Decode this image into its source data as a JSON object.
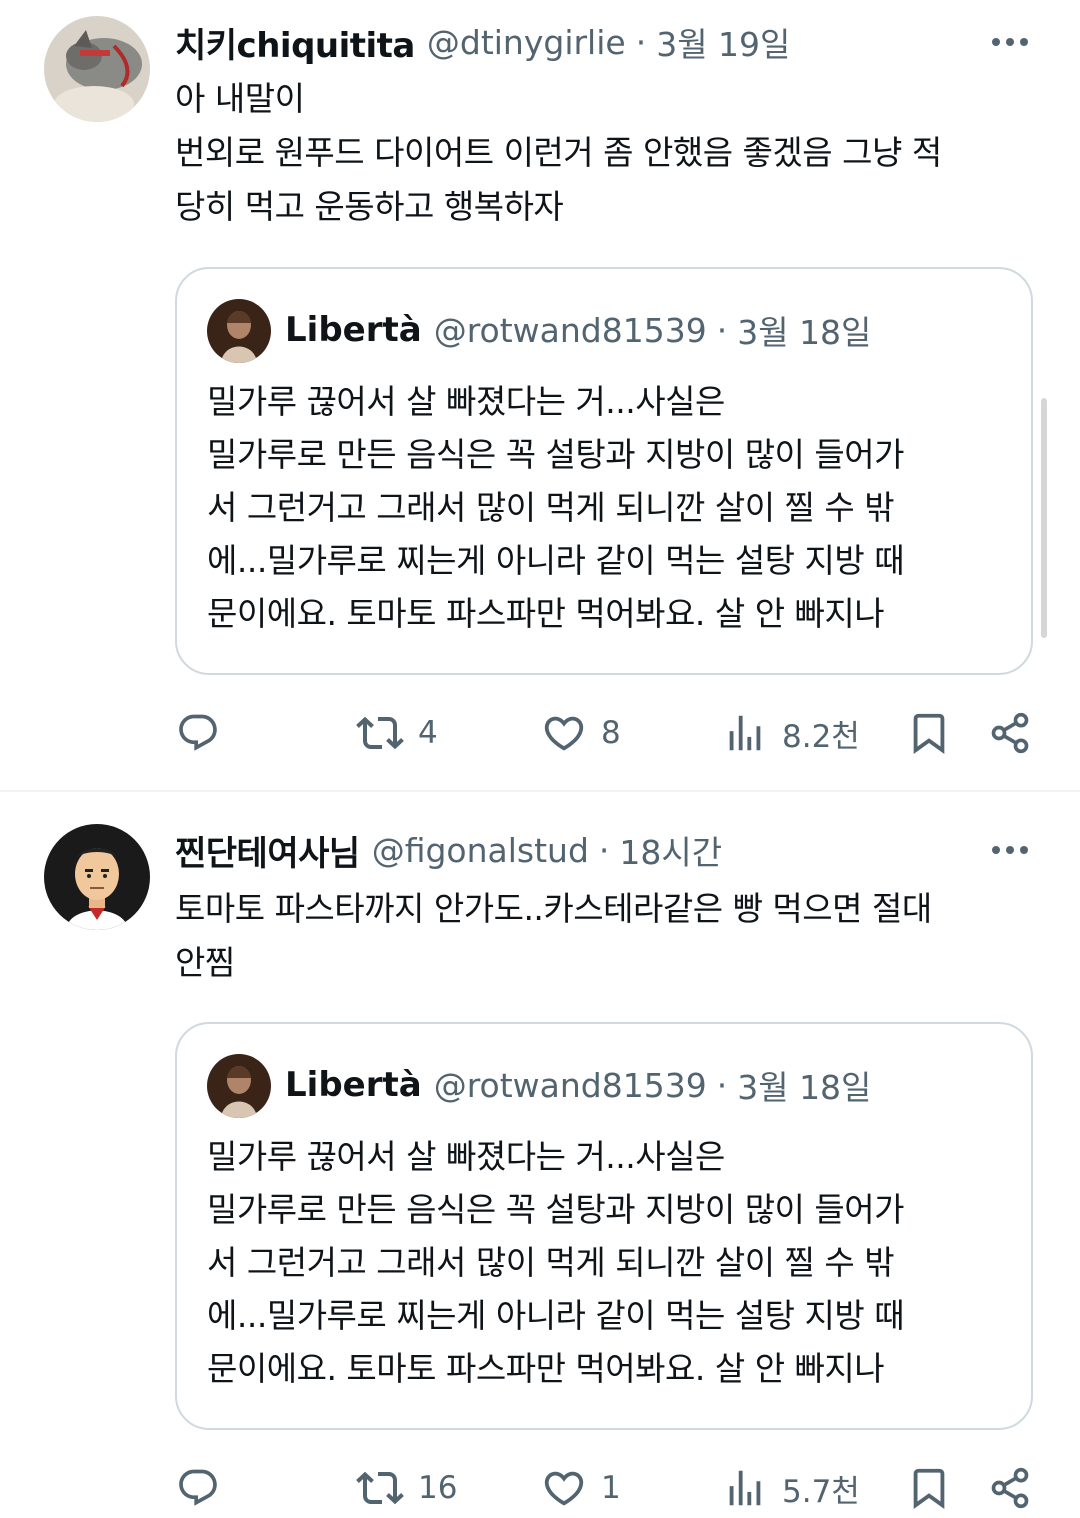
{
  "tweets": [
    {
      "name": "치키chiquitita",
      "handle": "@dtinygirlie",
      "time": "3월 19일",
      "text_lines": [
        "아 내말이",
        "번외로 원푸드 다이어트 이런거 좀 안했음 좋겠음 그냥 적",
        "당히 먹고 운동하고 행복하자"
      ],
      "quote": {
        "name": "Libertà",
        "handle": "@rotwand81539",
        "time": "3월 18일",
        "text_lines": [
          "밀가루 끊어서 살 빠졌다는 거...사실은",
          "밀가루로 만든 음식은 꼭 설탕과 지방이 많이 들어가",
          "서 그런거고 그래서 많이 먹게 되니깐 살이 찔 수 밖",
          "에...밀가루로 찌는게 아니라 같이 먹는 설탕 지방 때",
          "문이에요. 토마토 파스파만 먹어봐요. 살 안 빠지나"
        ]
      },
      "actions": {
        "replies": "",
        "retweets": "4",
        "likes": "8",
        "views": "8.2천"
      }
    },
    {
      "name": "찐단테여사님",
      "handle": "@figonalstud",
      "time": "18시간",
      "text_lines": [
        "토마토 파스타까지 안가도..카스테라같은 빵 먹으면 절대",
        "안찜"
      ],
      "quote": {
        "name": "Libertà",
        "handle": "@rotwand81539",
        "time": "3월 18일",
        "text_lines": [
          "밀가루 끊어서 살 빠졌다는 거...사실은",
          "밀가루로 만든 음식은 꼭 설탕과 지방이 많이 들어가",
          "서 그런거고 그래서 많이 먹게 되니깐 살이 찔 수 밖",
          "에...밀가루로 찌는게 아니라 같이 먹는 설탕 지방 때",
          "문이에요. 토마토 파스파만 먹어봐요. 살 안 빠지나"
        ]
      },
      "actions": {
        "replies": "",
        "retweets": "16",
        "likes": "1",
        "views": "5.7천"
      }
    }
  ],
  "separator": "·",
  "colors": {
    "text": "#0f1419",
    "secondary": "#536471",
    "border": "#cfd9de"
  }
}
